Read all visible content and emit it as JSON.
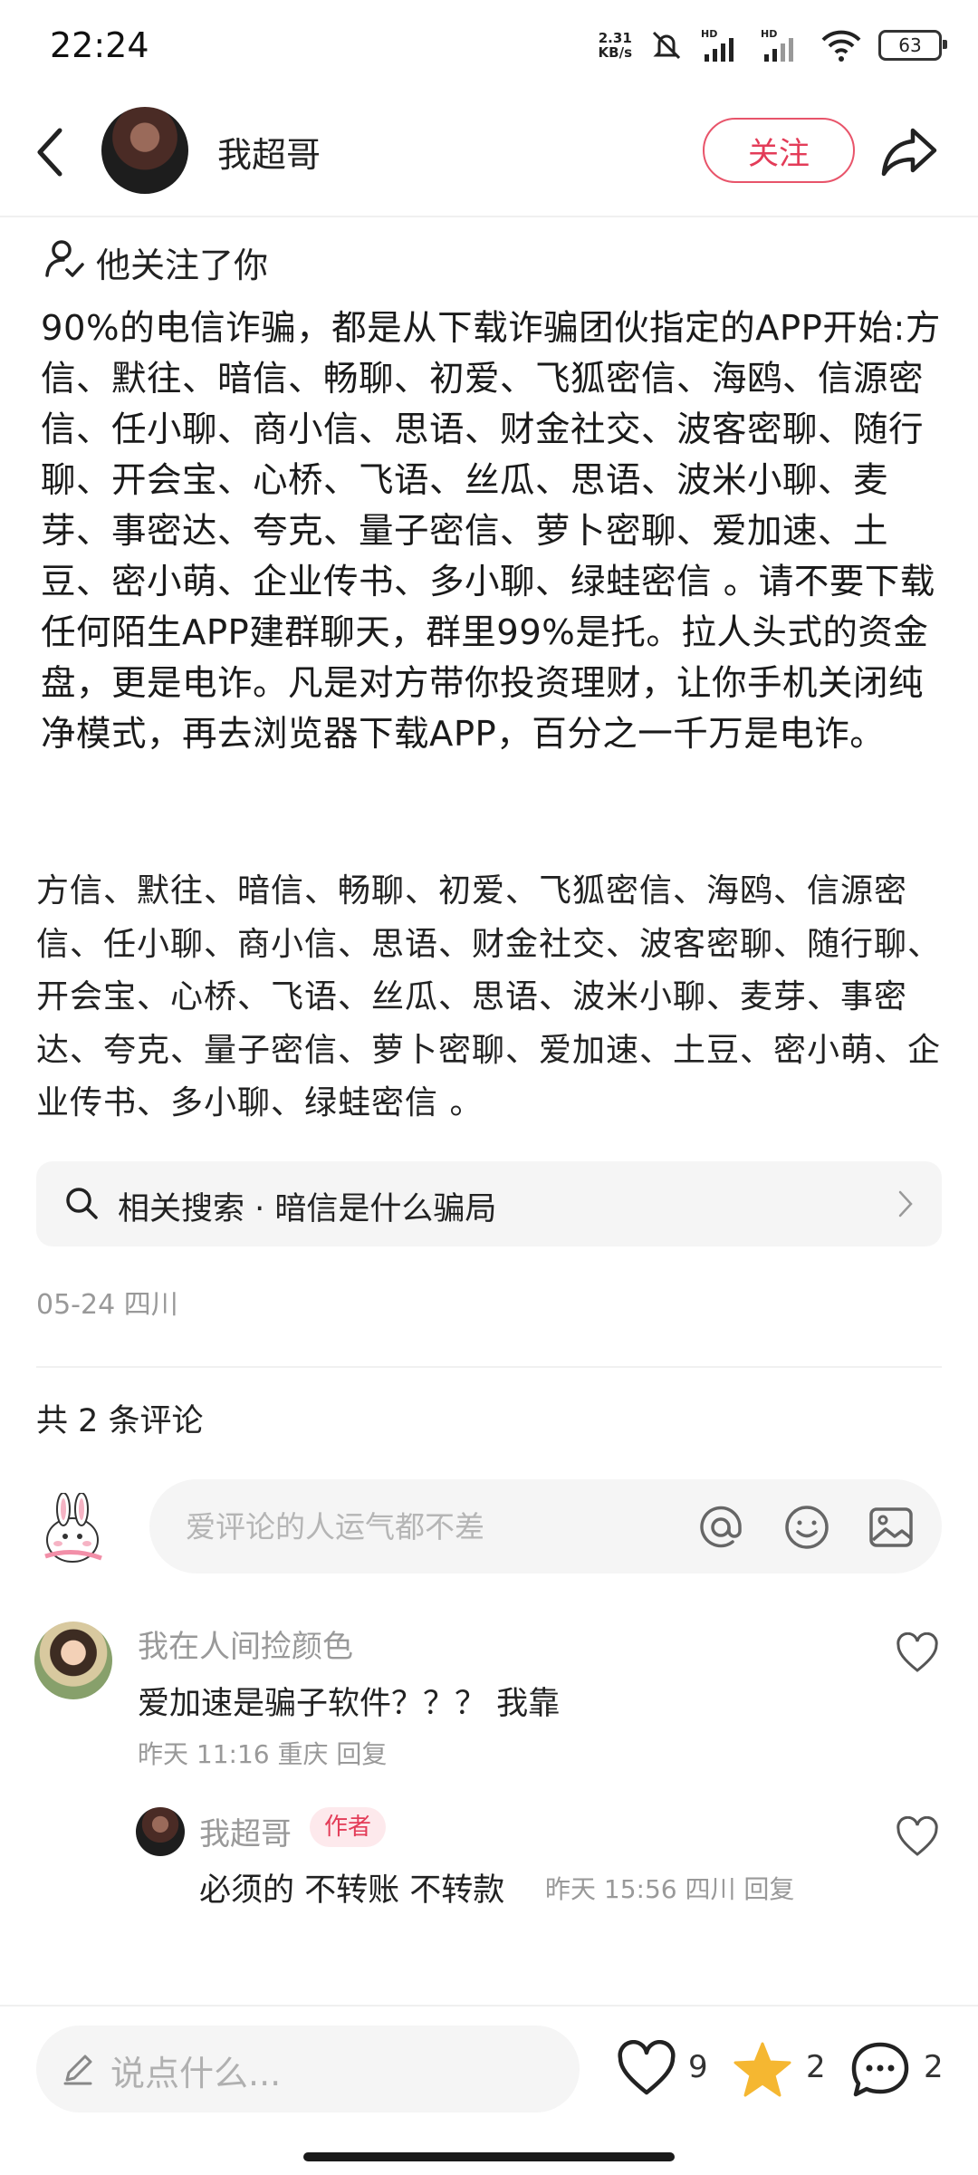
{
  "status_bar": {
    "time": "22:24",
    "net_speed_value": "2.31",
    "net_speed_unit": "KB/s",
    "battery": "63",
    "signal_label_1": "HD",
    "signal_label_2": "HD"
  },
  "header": {
    "username": "我超哥",
    "follow_label": "关注",
    "back_icon": "chevron-left-icon",
    "share_icon": "share-arrow-icon"
  },
  "follows_you": "他关注了你",
  "post": {
    "body": "90%的电信诈骗，都是从下载诈骗团伙指定的APP开始:方信、默往、暗信、畅聊、初爱、飞狐密信、海鸥、信源密信、任小聊、商小信、思语、财金社交、波客密聊、随行聊、开会宝、心桥、飞语、丝瓜、思语、波米小聊、麦芽、事密达、夸克、量子密信、萝卜密聊、爱加速、土豆、密小萌、企业传书、多小聊、绿蛙密信 。请不要下载任何陌生APP建群聊天，群里99%是托。拉人头式的资金盘，更是电诈。凡是对方带你投资理财，让你手机关闭纯净模式，再去浏览器下载APP，百分之一千万是电诈。",
    "app_list": "方信、默往、暗信、畅聊、初爱、飞狐密信、海鸥、信源密信、任小聊、商小信、思语、财金社交、波客密聊、随行聊、开会宝、心桥、飞语、丝瓜、思语、波米小聊、麦芽、事密达、夸克、量子密信、萝卜密聊、爱加速、土豆、密小萌、企业传书、多小聊、绿蛙密信 。",
    "related_search": "相关搜索 · 暗信是什么骗局",
    "meta": "05-24 四川"
  },
  "comments_section": {
    "count_label": "共 2 条评论",
    "input_placeholder": "爱评论的人运气都不差",
    "comments": [
      {
        "name": "我在人间捡颜色",
        "text": "爱加速是骗子软件？？？  我靠",
        "meta": "昨天 11:16 重庆  回复"
      },
      {
        "name": "我超哥",
        "badge": "作者",
        "text": "必须的  不转账  不转款",
        "meta": "昨天 15:56 四川  回复"
      }
    ]
  },
  "bottom_bar": {
    "input_label": "说点什么...",
    "likes": "9",
    "stars": "2",
    "comments": "2"
  },
  "colors": {
    "accent": "#e33c58",
    "star": "#f5b731",
    "secondary_text": "#999999"
  }
}
